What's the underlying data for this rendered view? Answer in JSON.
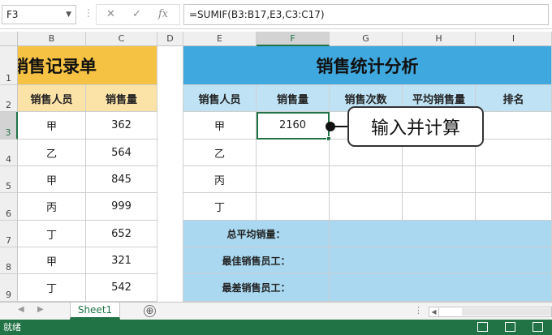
{
  "formula_bar": {
    "name_box": "F3",
    "separator": "⋮",
    "cancel_icon": "✕",
    "enter_icon": "✓",
    "fx_icon": "fx",
    "formula": "=SUMIF(B3:B17,E3,C3:C17)"
  },
  "columns": [
    "B",
    "C",
    "D",
    "E",
    "F",
    "G",
    "H",
    "I"
  ],
  "rows": [
    "1",
    "2",
    "3",
    "4",
    "5",
    "6",
    "7",
    "8",
    "9"
  ],
  "left_table": {
    "title": "销售记录单",
    "headers": [
      "销售人员",
      "销售量"
    ],
    "rows": [
      [
        "甲",
        "362"
      ],
      [
        "乙",
        "564"
      ],
      [
        "甲",
        "845"
      ],
      [
        "丙",
        "999"
      ],
      [
        "丁",
        "652"
      ],
      [
        "甲",
        "321"
      ],
      [
        "丁",
        "542"
      ]
    ]
  },
  "right_table": {
    "title": "销售统计分析",
    "headers": [
      "销售人员",
      "销售量",
      "销售次数",
      "平均销售量",
      "排名"
    ],
    "rows": [
      [
        "甲",
        "2160",
        "",
        "",
        ""
      ],
      [
        "乙",
        "",
        "",
        "",
        ""
      ],
      [
        "丙",
        "",
        "",
        "",
        ""
      ],
      [
        "丁",
        "",
        "",
        "",
        ""
      ]
    ],
    "summary": [
      "总平均销量：",
      "最佳销售员工：",
      "最差销售员工："
    ]
  },
  "callout": "输入并计算",
  "sheet_tab": "Sheet1",
  "add_sheet": "⊕",
  "status": "就绪",
  "colors": {
    "accent": "#217346",
    "left_title_bg": "#f5c243",
    "left_header_bg": "#fbe3a8",
    "right_title_bg": "#3fa8df",
    "right_header_bg": "#bfe3f5",
    "summary_bg": "#a9d8f0"
  }
}
